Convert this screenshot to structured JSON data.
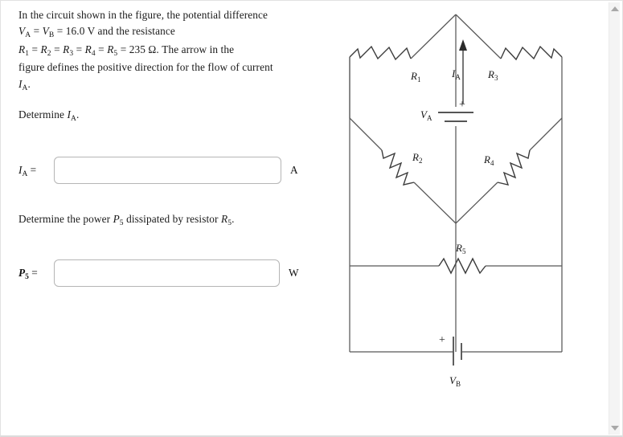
{
  "window": {
    "scrollbar": {
      "up_arrow": "scroll-up",
      "down_arrow": "scroll-down"
    }
  },
  "problem": {
    "statement_lines": [
      "In the circuit shown in the figure, the potential difference",
      "Vᴀ = Vʙ = 16.0 V and the resistance",
      "R₁ = R₂ = R₃ = R₄ = R₅ = 235 Ω. The arrow in the",
      "figure defines the positive direction for the flow of current",
      "Iᴀ."
    ],
    "statement_text": "In the circuit shown in the figure, the potential difference VA = VB = 16.0 V and the resistance R1 = R2 = R3 = R4 = R5 = 235 Ω. The arrow in the figure defines the positive direction for the flow of current IA.",
    "voltage_value": "16.0 V",
    "resistance_value": "235 Ω",
    "question_1": "Determine IA.",
    "question_2": "Determine the power P5 dissipated by resistor R5."
  },
  "answers": {
    "ia": {
      "label": "I",
      "label_sub": "A",
      "equals": "=",
      "value": "",
      "placeholder": "",
      "unit": "A"
    },
    "p5": {
      "label": "P",
      "label_sub": "5",
      "equals": "=",
      "value": "",
      "placeholder": "",
      "unit": "W"
    }
  },
  "figure": {
    "title": "circuit-diagram",
    "components": {
      "r1": {
        "label": "R",
        "sub": "1"
      },
      "r2": {
        "label": "R",
        "sub": "2"
      },
      "r3": {
        "label": "R",
        "sub": "3"
      },
      "r4": {
        "label": "R",
        "sub": "4"
      },
      "r5": {
        "label": "R",
        "sub": "5"
      },
      "va": {
        "label": "V",
        "sub": "A",
        "polarity": "+"
      },
      "vb": {
        "label": "V",
        "sub": "B",
        "polarity": "+"
      },
      "ia": {
        "label": "I",
        "sub": "A",
        "direction": "up"
      }
    },
    "colors": {
      "wire": "#585858",
      "text": "#1a1a1a"
    }
  }
}
